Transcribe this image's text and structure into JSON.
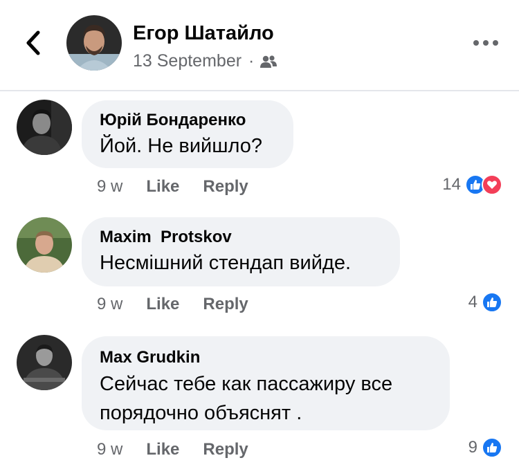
{
  "post": {
    "author": "Егор Шатайло",
    "date": "13 September",
    "separator": "·",
    "audience_icon": "friends-icon"
  },
  "comments": [
    {
      "author": "Юрій Бондаренко",
      "text": "Йой. Не вийшло?",
      "time": "9 w",
      "like_label": "Like",
      "reply_label": "Reply",
      "reaction_count": "14",
      "reactions": [
        "like",
        "love"
      ]
    },
    {
      "author": "Maxim  Protskov",
      "text": "Несмішний стендап вийде.",
      "time": "9 w",
      "like_label": "Like",
      "reply_label": "Reply",
      "reaction_count": "4",
      "reactions": [
        "like"
      ]
    },
    {
      "author": "Max Grudkin",
      "text": "Сейчас тебе как пассажиру все\nпорядочно объяснят .",
      "time": "9 w",
      "like_label": "Like",
      "reply_label": "Reply",
      "reaction_count": "9",
      "reactions": [
        "like"
      ]
    }
  ],
  "colors": {
    "like_blue": "#1877f2",
    "love_red": "#f33e58",
    "bubble_bg": "#f0f2f5",
    "secondary_text": "#65676b"
  }
}
